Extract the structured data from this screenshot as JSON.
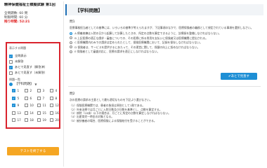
{
  "sidebar": {
    "exam_title": "精神保健福祉士模擬試験 第1回",
    "stats": [
      {
        "label": "全問題数: 60 問"
      },
      {
        "label": "制限時間: 60 分"
      }
    ],
    "remaining": "残り時間: 52:21",
    "filter_heading": "表示する問題",
    "filters": [
      {
        "label": "全問表示",
        "checked": true
      },
      {
        "label": "未解答",
        "checked": false
      },
      {
        "label": "あとで見直す（解答済）",
        "checked": true
      },
      {
        "label": "あとで見直す（未解答）",
        "checked": false
      }
    ],
    "category_heading": "問題一覧",
    "category_label": "【学科問題】",
    "questions": [
      {
        "no": "1",
        "checked": true
      },
      {
        "no": "2",
        "checked": false
      },
      {
        "no": "3",
        "checked": false
      },
      {
        "no": "4",
        "checked": false
      },
      {
        "no": "5",
        "checked": true
      },
      {
        "no": "6",
        "checked": false
      },
      {
        "no": "7",
        "checked": false
      },
      {
        "no": "8",
        "checked": false
      },
      {
        "no": "9",
        "checked": true
      },
      {
        "no": "10",
        "checked": false
      },
      {
        "no": "11",
        "checked": false
      },
      {
        "no": "12",
        "checked": false
      },
      {
        "no": "13",
        "checked": false
      },
      {
        "no": "14",
        "checked": false
      },
      {
        "no": "15",
        "checked": false
      },
      {
        "no": "16",
        "checked": false
      },
      {
        "no": "17",
        "checked": false
      },
      {
        "no": "18",
        "checked": false
      },
      {
        "no": "19",
        "checked": false
      },
      {
        "no": "20",
        "checked": false
      }
    ],
    "end_button": "テストを終了する"
  },
  "main": {
    "title": "【学科問題】",
    "q1": {
      "no": "問1",
      "text": "医療事務担当者としての基準には、いろいろの基準が考えられますが、下記事項のなかで、医療保険者の義務として規定されている事項を選択しなさい。",
      "options": [
        {
          "text": "A 療養病棟は入院の日から起算して計算したときの、所定の点数を算定できるように、診療録を整備しなければならない。",
          "selected": true
        },
        {
          "text": "B 上記医療の適正な請求・審査についての、その医療に係る費用を支払いに保険者又は医療機関に提出される。",
          "selected": false
        },
        {
          "text": "C 医療機関内のみでの請求は定められたとして、保険医療機関において、記録を保存しなければならない。",
          "selected": false
        },
        {
          "text": "D 保険者は、サービスを提供するにあたって、その運営に関して、保健の向上に努めなければならない。",
          "selected": false
        },
        {
          "text": "E 保険者として審査対応に、医療の請求を適正にしなければならない。",
          "selected": false
        }
      ],
      "review_button": "✔あとで見直す"
    },
    "q2": {
      "no": "問2",
      "text": "次の医療の請求の主意として最も適切なものを下記より選びなさい。",
      "items": [
        "（1）保険医療機関では、患者の負担は原則として1割である。",
        "（2）外来治療では月ごとに入院日数及び日数を基準とし、点数を算定する。",
        "（3）病院（20床）以下の場合は、月ごとに所定の点数を算定しなければならない。",
        "（4）出産育児一時金の対象となる。",
        "（5）被扶養者の場合、医療保険による保険給付を受けることができる。"
      ]
    }
  }
}
